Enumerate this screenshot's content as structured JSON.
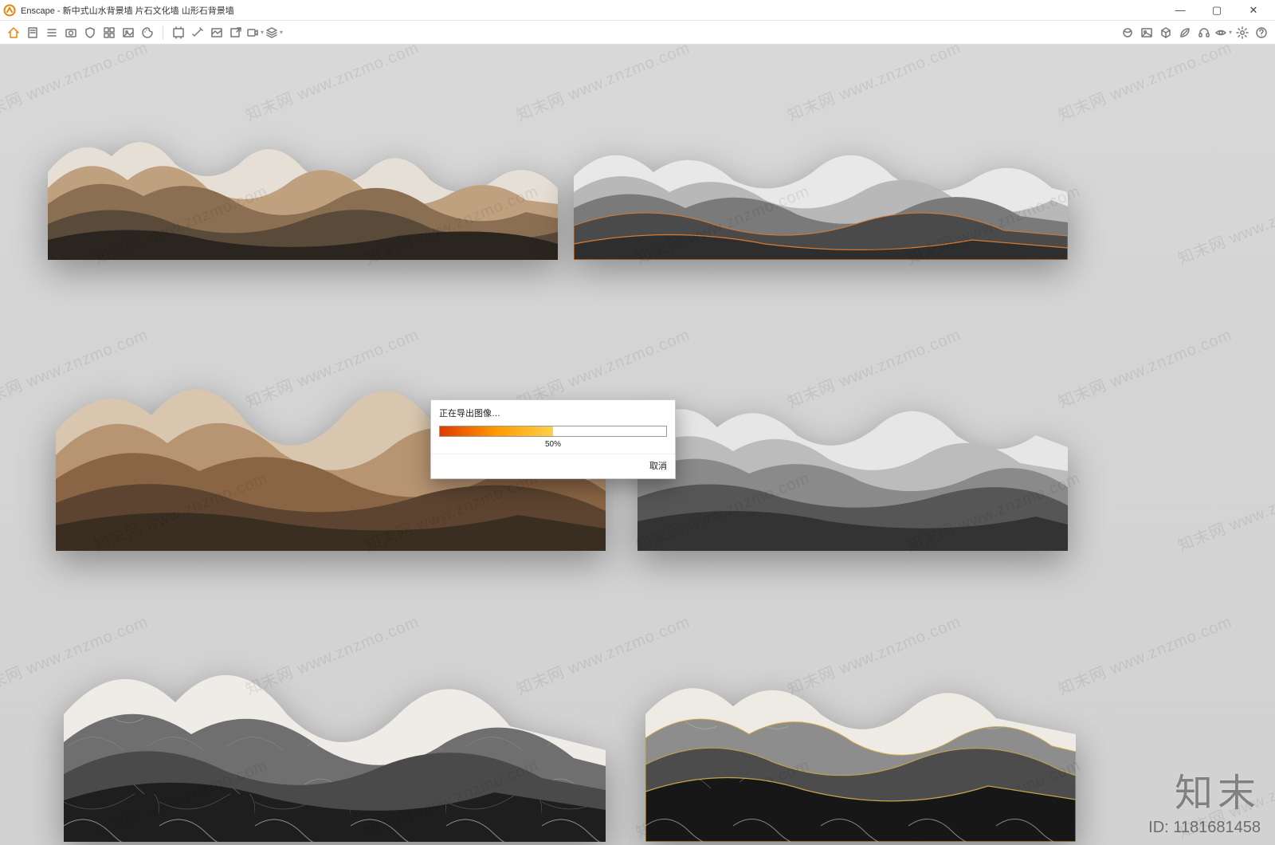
{
  "app": {
    "name": "Enscape",
    "title": "Enscape - 新中式山水背景墙 片石文化墙 山形石背景墙"
  },
  "window": {
    "min": "—",
    "max": "▢",
    "close": "✕"
  },
  "toolbar_icons": [
    {
      "name": "home-icon",
      "home": true
    },
    {
      "name": "page-icon"
    },
    {
      "name": "list-icon"
    },
    {
      "name": "camera-icon"
    },
    {
      "name": "shield-icon"
    },
    {
      "name": "grid-icon"
    },
    {
      "name": "image-icon"
    },
    {
      "name": "palette-icon"
    },
    {
      "name": "sep"
    },
    {
      "name": "screenshot-icon"
    },
    {
      "name": "wand-icon"
    },
    {
      "name": "gallery-icon"
    },
    {
      "name": "export-image-icon"
    },
    {
      "name": "video-icon",
      "dd": true
    },
    {
      "name": "layers-icon",
      "dd": true
    }
  ],
  "toolbar_icons_right": [
    {
      "name": "material-icon"
    },
    {
      "name": "picture-icon"
    },
    {
      "name": "cube-icon"
    },
    {
      "name": "leaf-icon"
    },
    {
      "name": "headset-icon"
    },
    {
      "name": "eye-icon",
      "dd": true
    },
    {
      "name": "gear-icon"
    },
    {
      "name": "help-icon"
    }
  ],
  "dialog": {
    "title": "正在导出图像…",
    "percent_value": 50,
    "percent_label": "50%",
    "cancel": "取消"
  },
  "watermark": {
    "text": "知末网 www.znzmo.com"
  },
  "brand": {
    "name": "知末",
    "id_label": "ID: 1181681458"
  }
}
